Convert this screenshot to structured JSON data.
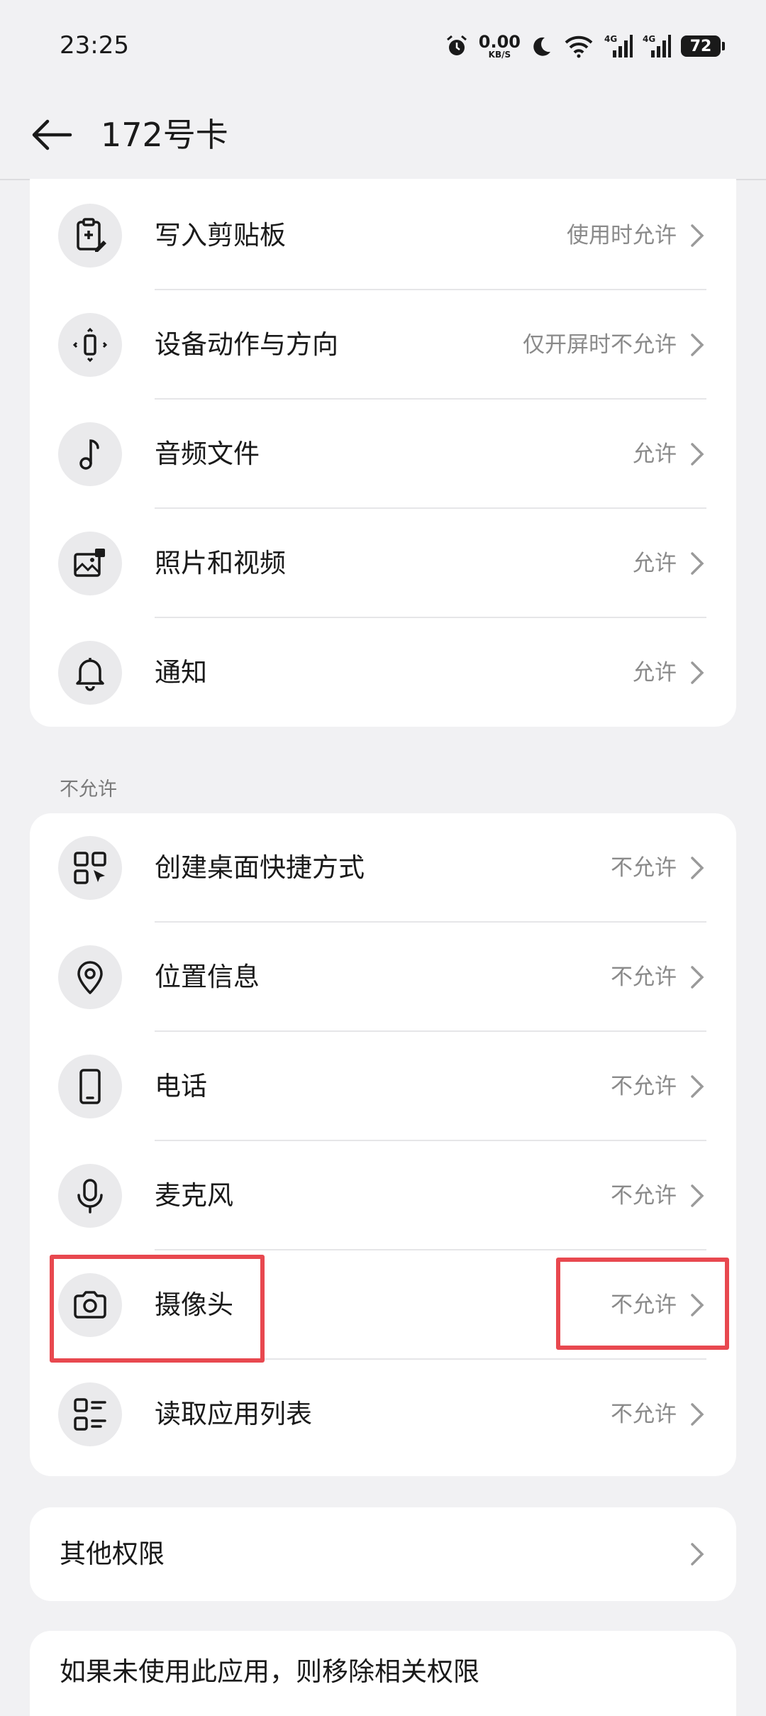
{
  "status_bar": {
    "time": "23:25",
    "net_speed_value": "0.00",
    "net_speed_unit": "KB/S",
    "battery": "72",
    "icons": [
      "alarm-icon",
      "moon-icon",
      "wifi-icon",
      "signal-4g-icon",
      "signal-4g-icon",
      "battery-icon"
    ]
  },
  "header": {
    "title": "172号卡"
  },
  "allowed_items": [
    {
      "label": "写入剪贴板",
      "value": "使用时允许",
      "icon": "clipboard-icon"
    },
    {
      "label": "设备动作与方向",
      "value": "仅开屏时不允许",
      "icon": "motion-icon"
    },
    {
      "label": "音频文件",
      "value": "允许",
      "icon": "music-note-icon"
    },
    {
      "label": "照片和视频",
      "value": "允许",
      "icon": "photos-icon"
    },
    {
      "label": "通知",
      "value": "允许",
      "icon": "bell-icon"
    }
  ],
  "denied_section": {
    "title": "不允许",
    "items": [
      {
        "label": "创建桌面快捷方式",
        "value": "不允许",
        "icon": "shortcut-grid-icon"
      },
      {
        "label": "位置信息",
        "value": "不允许",
        "icon": "location-pin-icon"
      },
      {
        "label": "电话",
        "value": "不允许",
        "icon": "phone-icon"
      },
      {
        "label": "麦克风",
        "value": "不允许",
        "icon": "microphone-icon"
      },
      {
        "label": "摄像头",
        "value": "不允许",
        "icon": "camera-icon"
      },
      {
        "label": "读取应用列表",
        "value": "不允许",
        "icon": "app-list-icon"
      }
    ]
  },
  "other_permissions": {
    "label": "其他权限"
  },
  "remove_if_unused": {
    "label": "如果未使用此应用，则移除相关权限"
  },
  "colors": {
    "background": "#f1f1f3",
    "card": "#ffffff",
    "highlight": "#e8484f",
    "secondary_text": "#8a8a8a"
  }
}
